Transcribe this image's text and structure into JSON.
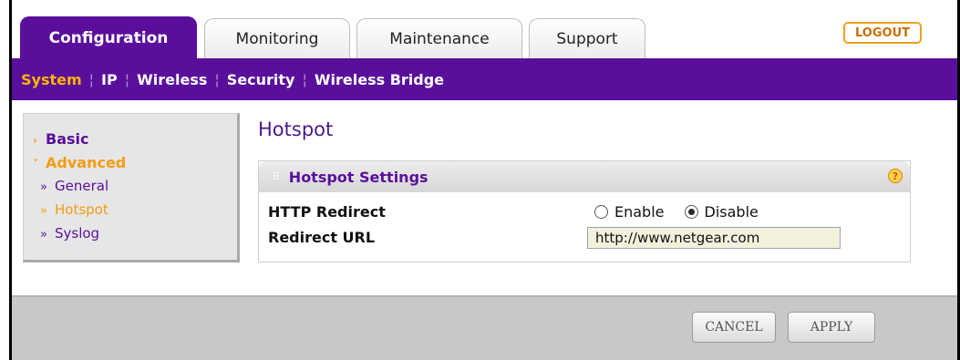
{
  "tabs": [
    {
      "label": "Configuration",
      "active": true
    },
    {
      "label": "Monitoring"
    },
    {
      "label": "Maintenance"
    },
    {
      "label": "Support"
    }
  ],
  "logout_label": "LOGOUT",
  "subnav": [
    {
      "label": "System",
      "active": true
    },
    {
      "label": "IP"
    },
    {
      "label": "Wireless"
    },
    {
      "label": "Security"
    },
    {
      "label": "Wireless Bridge"
    }
  ],
  "sidebar": {
    "basic": "Basic",
    "advanced": "Advanced",
    "items": [
      {
        "label": "General"
      },
      {
        "label": "Hotspot",
        "active": true
      },
      {
        "label": "Syslog"
      }
    ]
  },
  "page": {
    "title": "Hotspot",
    "panel_title": "Hotspot Settings",
    "http_redirect_label": "HTTP Redirect",
    "enable_label": "Enable",
    "disable_label": "Disable",
    "selected": "Disable",
    "redirect_url_label": "Redirect URL",
    "redirect_url_value": "http://www.netgear.com"
  },
  "buttons": {
    "cancel": "CANCEL",
    "apply": "APPLY"
  },
  "colors": {
    "brand_purple": "#5a0f9c",
    "accent_orange": "#f39c12"
  }
}
